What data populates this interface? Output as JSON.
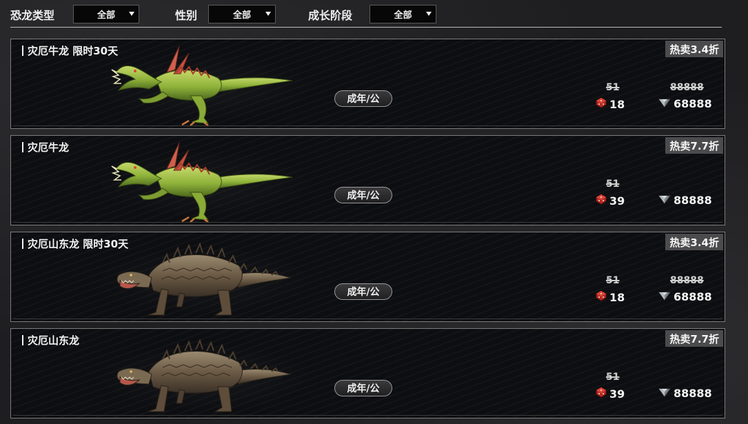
{
  "filters": [
    {
      "label": "恐龙类型",
      "value": "全部"
    },
    {
      "label": "性别",
      "value": "全部"
    },
    {
      "label": "成长阶段",
      "value": "全部"
    }
  ],
  "cards": [
    {
      "name": "灾厄牛龙 限时30天",
      "sale": "热卖3.4折",
      "stage": "成年/公",
      "dice_old": "51",
      "dice_new": "18",
      "gem_old": "88888",
      "gem_new": "68888",
      "art": "raptor"
    },
    {
      "name": "灾厄牛龙",
      "sale": "热卖7.7折",
      "stage": "成年/公",
      "dice_old": "51",
      "dice_new": "39",
      "gem_old": "",
      "gem_new": "88888",
      "art": "raptor"
    },
    {
      "name": "灾厄山东龙 限时30天",
      "sale": "热卖3.4折",
      "stage": "成年/公",
      "dice_old": "51",
      "dice_new": "18",
      "gem_old": "88888",
      "gem_new": "68888",
      "art": "ankylo"
    },
    {
      "name": "灾厄山东龙",
      "sale": "热卖7.7折",
      "stage": "成年/公",
      "dice_old": "51",
      "dice_new": "39",
      "gem_old": "",
      "gem_new": "88888",
      "art": "ankylo"
    }
  ],
  "icons": {
    "dice": "red-dice-icon",
    "gem": "silver-gem-icon",
    "dropdown": "dropdown-caret-icon"
  },
  "colors": {
    "accent_red": "#c0392b",
    "raptor_green": "#8fb33a",
    "ankylo_brown": "#6b5a45"
  }
}
